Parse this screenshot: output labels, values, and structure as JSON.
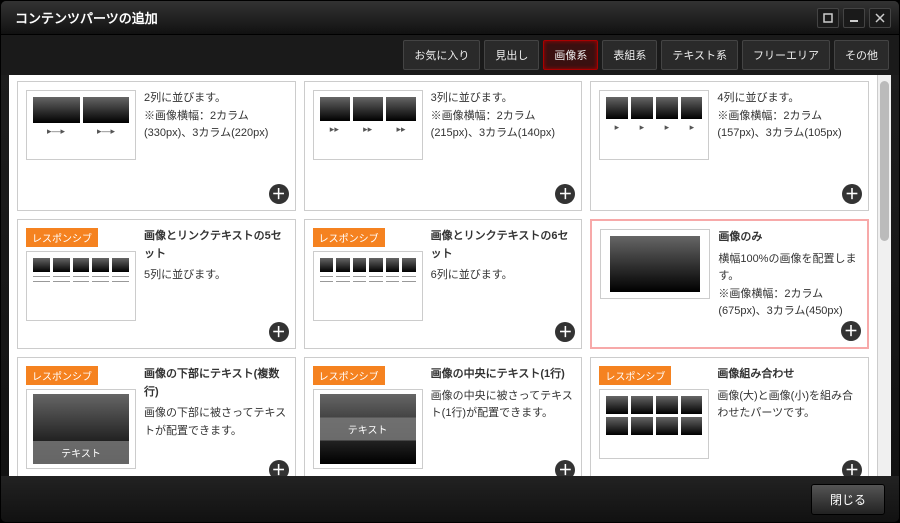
{
  "window": {
    "title": "コンテンツパーツの追加"
  },
  "tabs": [
    {
      "label": "お気に入り",
      "active": false
    },
    {
      "label": "見出し",
      "active": false
    },
    {
      "label": "画像系",
      "active": true
    },
    {
      "label": "表組系",
      "active": false
    },
    {
      "label": "テキスト系",
      "active": false
    },
    {
      "label": "フリーエリア",
      "active": false
    },
    {
      "label": "その他",
      "active": false
    }
  ],
  "badge_label": "レスポンシブ",
  "text_label": "テキスト",
  "cards": [
    {
      "title": "",
      "body": "2列に並びます。\n※画像横幅：2カラム(330px)、3カラム(220px)",
      "badge": false,
      "thumb": "row2arrow",
      "highlight": false
    },
    {
      "title": "",
      "body": "3列に並びます。\n※画像横幅：2カラム(215px)、3カラム(140px)",
      "badge": false,
      "thumb": "row3arrow",
      "highlight": false
    },
    {
      "title": "",
      "body": "4列に並びます。\n※画像横幅：2カラム(157px)、3カラム(105px)",
      "badge": false,
      "thumb": "row4arrow",
      "highlight": false
    },
    {
      "title": "画像とリンクテキストの5セット",
      "body": "5列に並びます。",
      "badge": true,
      "thumb": "row5under",
      "highlight": false
    },
    {
      "title": "画像とリンクテキストの6セット",
      "body": "6列に並びます。",
      "badge": true,
      "thumb": "row6under",
      "highlight": false
    },
    {
      "title": "画像のみ",
      "body": "横幅100%の画像を配置します。\n※画像横幅：2カラム(675px)、3カラム(450px)",
      "badge": false,
      "thumb": "single",
      "highlight": true
    },
    {
      "title": "画像の下部にテキスト(複数行)",
      "body": "画像の下部に被さってテキストが配置できます。",
      "badge": true,
      "thumb": "textbottom",
      "highlight": false
    },
    {
      "title": "画像の中央にテキスト(1行)",
      "body": "画像の中央に被さってテキスト(1行)が配置できます。",
      "badge": true,
      "thumb": "textcenter",
      "highlight": false
    },
    {
      "title": "画像組み合わせ",
      "body": "画像(大)と画像(小)を組み合わせたパーツです。",
      "badge": true,
      "thumb": "combo",
      "highlight": false
    }
  ],
  "footer": {
    "close": "閉じる"
  }
}
